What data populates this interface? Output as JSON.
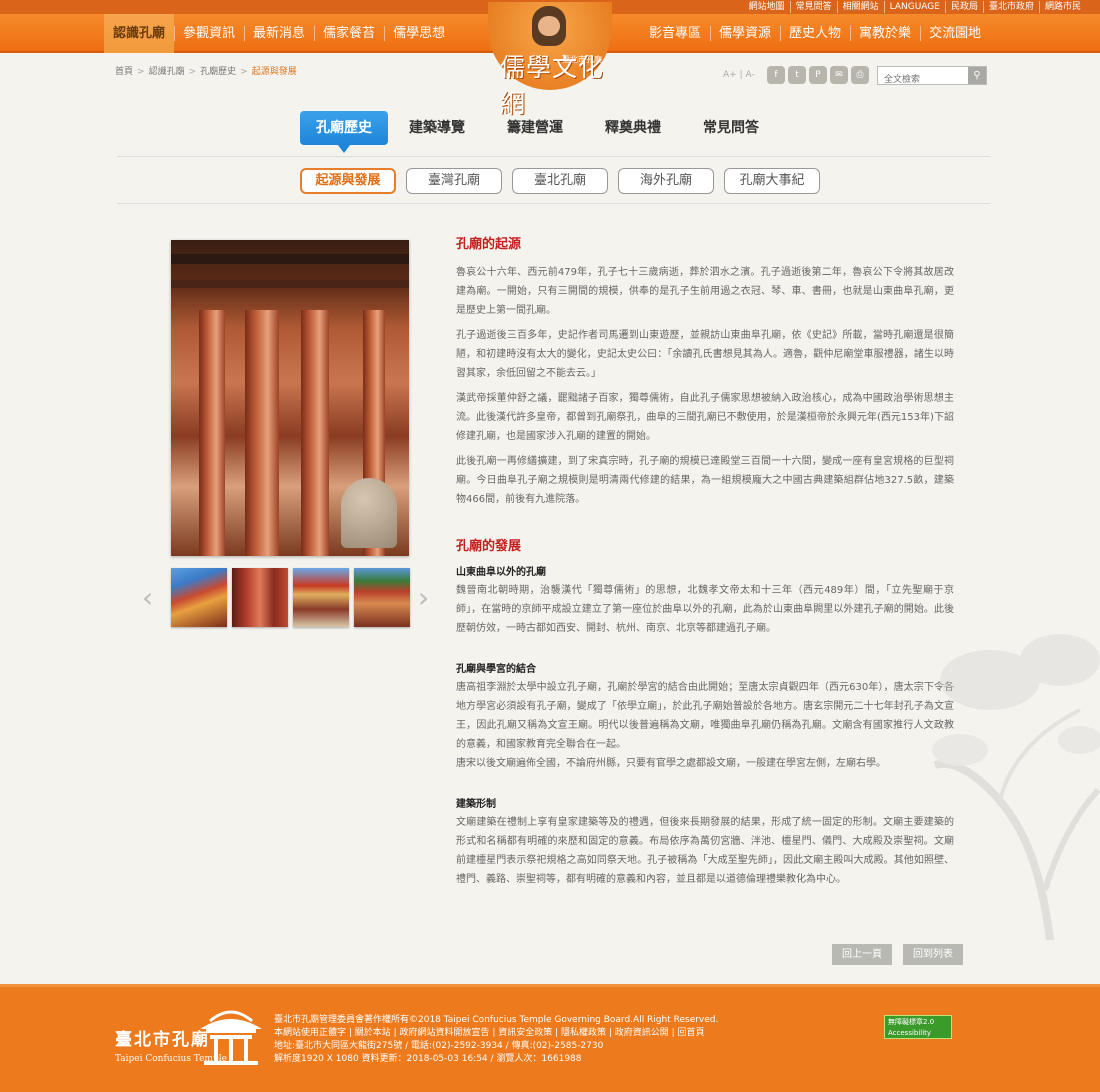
{
  "top_links": [
    "網站地圖",
    "常見問答",
    "相關網站",
    "LANGUAGE",
    "民政局",
    "臺北市政府",
    "網路市民"
  ],
  "nav_left": [
    "認識孔廟",
    "參觀資訊",
    "最新消息",
    "儒家餐苔",
    "儒學思想"
  ],
  "nav_right": [
    "影音專區",
    "儒學資源",
    "歷史人物",
    "寓教於樂",
    "交流園地"
  ],
  "logo": {
    "title": "儒學文化網",
    "sub": "臺北市孔廟"
  },
  "breadcrumb": [
    "首頁",
    "認識孔廟",
    "孔廟歷史",
    "起源與發展"
  ],
  "font_size": {
    "a_plus": "A+",
    "a_minus": "A-"
  },
  "share_icons": [
    "facebook-icon",
    "twitter-icon",
    "plurk-icon",
    "email-icon",
    "print-icon"
  ],
  "search": {
    "placeholder": "全文檢索"
  },
  "tabs": [
    "孔廟歷史",
    "建築導覽",
    "籌建營運",
    "釋奠典禮",
    "常見問答"
  ],
  "subtabs": [
    "起源與發展",
    "臺灣孔廟",
    "臺北孔廟",
    "海外孔廟",
    "孔廟大事紀"
  ],
  "article": {
    "h_origin": "孔廟的起源",
    "p1": "魯哀公十六年、西元前479年，孔子七十三歲病逝，葬於泗水之濱。孔子過逝後第二年，魯哀公下令將其故居改建為廟。一開始，只有三開間的規模，供奉的是孔子生前用過之衣冠、琴、車、書冊，也就是山東曲阜孔廟，更是歷史上第一間孔廟。",
    "p2": "孔子過逝後三百多年，史記作者司馬遷到山東遊歷，並親訪山東曲阜孔廟，依《史記》所載，當時孔廟還是很簡陋，和初建時沒有太大的變化，史記太史公曰：「余讀孔氏書想見其為人。適魯，觀仲尼廟堂車服禮器，諸生以時習其家，余低回留之不能去云。」",
    "p3": "漢武帝採董仲舒之議，罷黜諸子百家，獨尊儒術，自此孔子儒家思想被納入政治核心，成為中國政治學術思想主流。此後漢代許多皇帝，都曾到孔廟祭孔，曲阜的三間孔廟已不敷使用，於是漢桓帝於永興元年(西元153年)下詔修建孔廟，也是國家涉入孔廟的建置的開始。",
    "p4": "此後孔廟一再修繕擴建，到了宋真宗時，孔子廟的規模已達殿堂三百間一十六間，變成一座有皇宮規格的巨型祠廟。今日曲阜孔子廟之規模則是明清兩代修建的結果，為一組規模龐大之中國古典建築組群佔地327.5畝，建築物466間，前後有九進院落。",
    "h_dev": "孔廟的發展",
    "s1_title": "山東曲阜以外的孔廟",
    "s1_body": "魏晉南北朝時期，治襲漢代「獨尊儒術」的思想，北魏孝文帝太和十三年（西元489年）間，「立先聖廟于京師」，在當時的京師平成設立建立了第一座位於曲阜以外的孔廟，此為於山東曲阜闕里以外建孔子廟的開始。此後歷朝仿效，一時古都如西安、開封、杭州、南京、北京等都建過孔子廟。",
    "s2_title": "孔廟與學宮的結合",
    "s2_body": "唐高祖李淵於太學中設立孔子廟，孔廟於學宮的結合由此開始；至唐太宗貞觀四年（西元630年），唐太宗下令各地方學宮必須設有孔子廟，變成了「依學立廟」，於此孔子廟始普設於各地方。唐玄宗開元二十七年封孔子為文宣王，因此孔廟又稱為文宣王廟。明代以後普遍稱為文廟，唯獨曲阜孔廟仍稱為孔廟。文廟含有國家推行人文政教的意義，和國家教育完全聯合在一起。",
    "s2_body2": "唐宋以後文廟遍佈全國，不論府州縣，只要有官學之處都設文廟，一般建在學宮左側，左廟右學。",
    "s3_title": "建築形制",
    "s3_body": "文廟建築在禮制上享有皇家建築等及的禮遇，但後來長期發展的結果，形成了統一固定的形制。文廟主要建築的形式和名稱都有明確的來歷和固定的意義。布局依序為萬仞宮牆、泮池、欞星門、儀門、大成殿及崇聖祠。文廟前建欞星門表示祭祀規格之高如同祭天地。孔子被稱為「大成至聖先師」，因此文廟主殿叫大成殿。其他如照壁、禮門、義路、崇聖祠等，都有明確的意義和內容，並且都是以道德倫理禮樂教化為中心。"
  },
  "buttons": {
    "prev": "回上一頁",
    "list": "回到列表"
  },
  "footer": {
    "logo_zh": "臺北市孔廟",
    "logo_en": "Taipei Confucius Temple",
    "line1": "臺北市孔廟管理委員會著作權所有©2018 Taipei Confucius Temple Governing Board.All Right Reserved.",
    "line2": "本網站使用正體字 | 關於本站 | 政府網站資料開放宣告 | 資訊安全政策 | 隱私權政策 | 政府資訊公開 | 回首頁",
    "line3": "地址:臺北市大同區大龍街275號 / 電話:(02)-2592-3934 / 傳真:(02)-2585-2730",
    "line4": "解析度1920 X 1080 資料更新：2018-05-03 16:54 / 瀏覽人次：1661988",
    "badge": "無障礙標章2.0 Accessibility"
  }
}
